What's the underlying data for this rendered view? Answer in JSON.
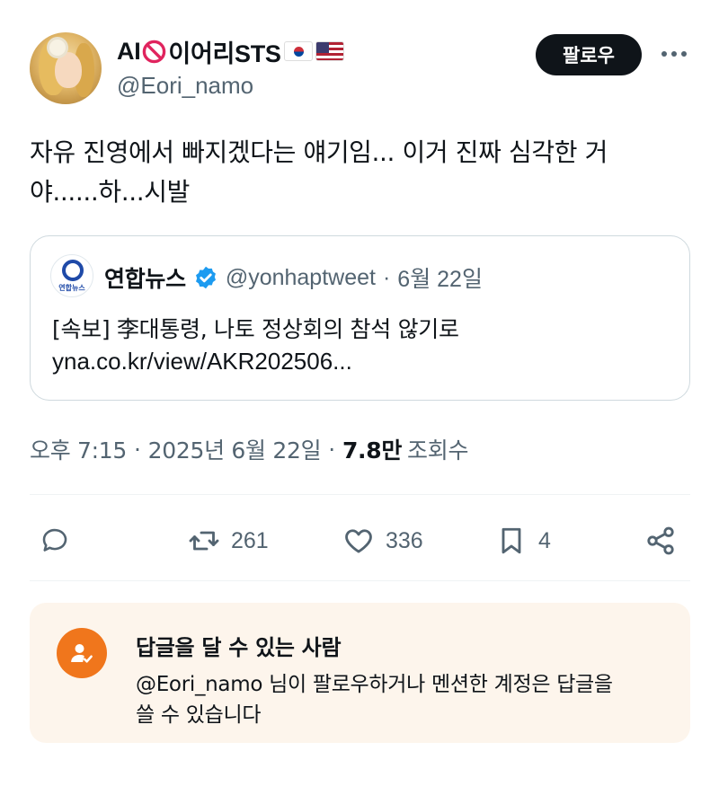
{
  "author": {
    "display_name_prefix": "AI",
    "display_name_suffix": "이어리STS",
    "handle": "@Eori_namo",
    "flags": [
      "kr-flag",
      "us-flag"
    ]
  },
  "follow_label": "팔로우",
  "tweet": {
    "line1": "자유 진영에서 빠지겠다는 얘기임... 이거 진짜 심각한 거",
    "line2": "야......하...시발"
  },
  "quote": {
    "avatar_label": "연합뉴스",
    "name": "연합뉴스",
    "handle": "@yonhaptweet",
    "dot": "·",
    "date": "6월 22일",
    "text": "[속보] 李대통령, 나토 정상회의 참석 않기로",
    "link": "yna.co.kr/view/AKR202506..."
  },
  "meta": {
    "time": "오후 7:15",
    "sep": "·",
    "date": "2025년 6월 22일",
    "views_count": "7.8만",
    "views_label": "조회수"
  },
  "actions": {
    "retweets": "261",
    "likes": "336",
    "bookmarks": "4"
  },
  "reply_notice": {
    "title": "답글을 달 수 있는 사람",
    "line1": "@Eori_namo 님이 팔로우하거나 멘션한 계정은 답글을",
    "line2": "쓸 수 있습니다"
  },
  "colors": {
    "text": "#0f1419",
    "secondary": "#536471",
    "verified": "#1d9bf0",
    "notice_bg": "#fdf5ec",
    "notice_icon": "#f0761c"
  }
}
